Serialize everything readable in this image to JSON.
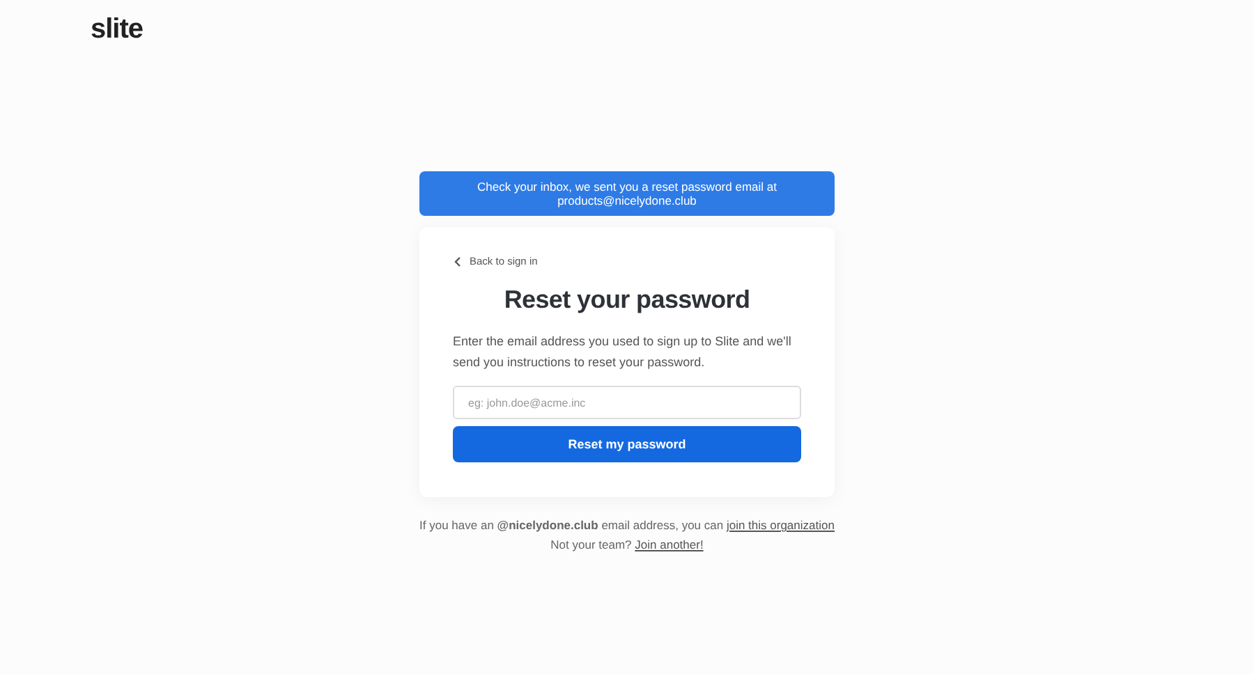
{
  "logo": "slite",
  "banner": {
    "text": "Check your inbox, we sent you a reset password email at products@nicelydone.club"
  },
  "card": {
    "back_link": "Back to sign in",
    "title": "Reset your password",
    "description": "Enter the email address you used to sign up to Slite and we'll send you instructions to reset your password.",
    "email_field": {
      "placeholder": "eg: john.doe@acme.inc"
    },
    "submit_button": "Reset my password"
  },
  "footer": [
    {
      "text": "If you have an **@nicelydone.club** email address, you can ",
      "link": "join this organization"
    },
    {
      "text": "Not your team? ",
      "link": "Join another!"
    }
  ]
}
